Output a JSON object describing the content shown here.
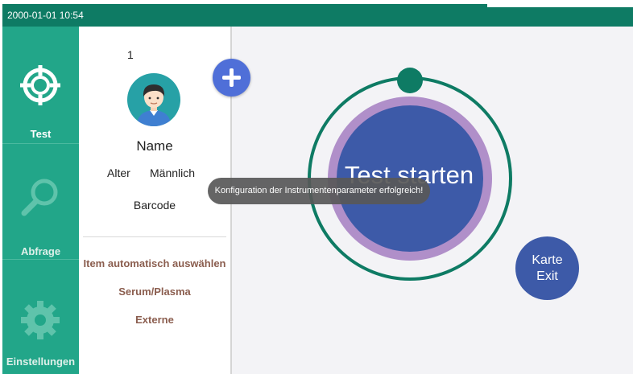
{
  "status_bar": {
    "time": "2000-01-01 10:54"
  },
  "nav": {
    "items": [
      {
        "label": "Test",
        "icon": "crosshair-icon"
      },
      {
        "label": "Abfrage",
        "icon": "search-icon"
      },
      {
        "label": "Einstellungen",
        "icon": "gear-icon"
      }
    ]
  },
  "patient": {
    "number": "1",
    "name": "Name",
    "age_label": "Alter",
    "gender": "Männlich",
    "barcode_label": "Barcode",
    "avatar_icon": "avatar-icon",
    "add_icon": "plus-icon",
    "options": [
      "Item automatisch auswählen",
      "Serum/Plasma",
      "Externe"
    ]
  },
  "main": {
    "start_button_label": "Test starten",
    "card_exit_line1": "Karte",
    "card_exit_line2": "Exit"
  },
  "toast": {
    "message": "Konfiguration der Instrumentenparameter erfolgreich!"
  },
  "colors": {
    "status_bar": "#0e7b64",
    "nav_background": "#22a689",
    "ring": "#0e7b64",
    "purple_ring": "#b08fc9",
    "start_button": "#3d5aa8",
    "add_button": "#4f6fd8",
    "option_text": "#8b5e4f"
  }
}
